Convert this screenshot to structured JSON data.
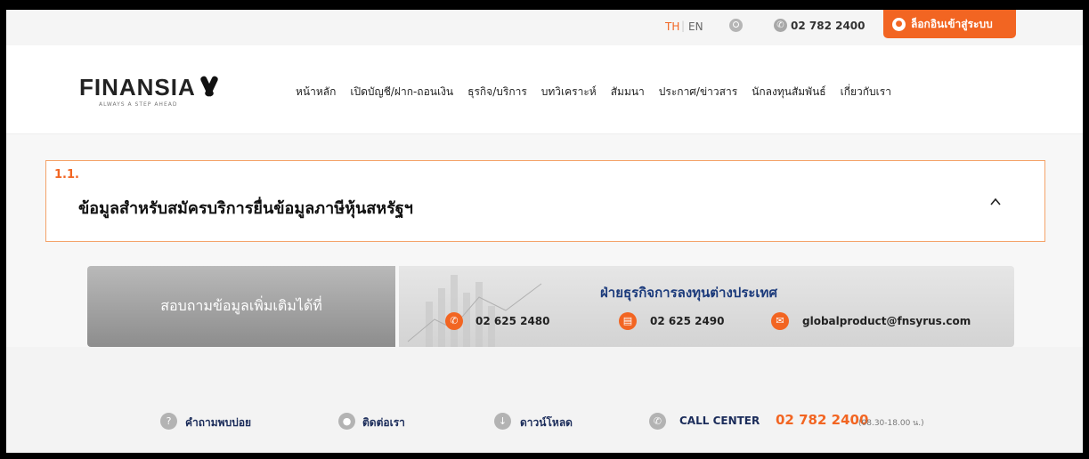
{
  "topbar": {
    "lang_th": "TH",
    "lang_separator": "|",
    "lang_en": "EN",
    "phone": "02 782 2400",
    "login_label": "ล็อกอินเข้าสู่ระบบ",
    "icons": [
      "search-icon",
      "phone-icon",
      "lock-icon"
    ]
  },
  "logo": {
    "text": "FINANSIA",
    "tagline": "ALWAYS A STEP AHEAD"
  },
  "nav": [
    "หน้าหลัก",
    "เปิดบัญชี/ฝาก-ถอนเงิน",
    "ธุรกิจ/บริการ",
    "บทวิเคราะห์",
    "สัมมนา",
    "ประกาศ/ข่าวสาร",
    "นักลงทุนสัมพันธ์",
    "เกี่ยวกับเรา"
  ],
  "section": {
    "number": "1.1.",
    "title": "ข้อมูลสำหรับสมัครบริการยื่นข้อมูลภาษีหุ้นสหรัฐฯ",
    "expanded": true
  },
  "contact": {
    "prompt": "สอบถามข้อมูลเพิ่มเติมได้ที่",
    "department": "ฝ่ายธุรกิจการลงทุนต่างประเทศ",
    "tel": "02 625 2480",
    "fax": "02 625 2490",
    "email": "globalproduct@fnsyrus.com"
  },
  "footer": {
    "faq": "คำถามพบบ่อย",
    "contact_us": "ติดต่อเรา",
    "download": "ดาวน์โหลด",
    "callcenter_label": "CALL CENTER",
    "callcenter_number": "02 782 2400",
    "callcenter_hours": "(08.30-18.00 น.)"
  },
  "colors": {
    "accent": "#f26522",
    "navy": "#1b3a7b",
    "border_accent": "#f4a36a"
  }
}
